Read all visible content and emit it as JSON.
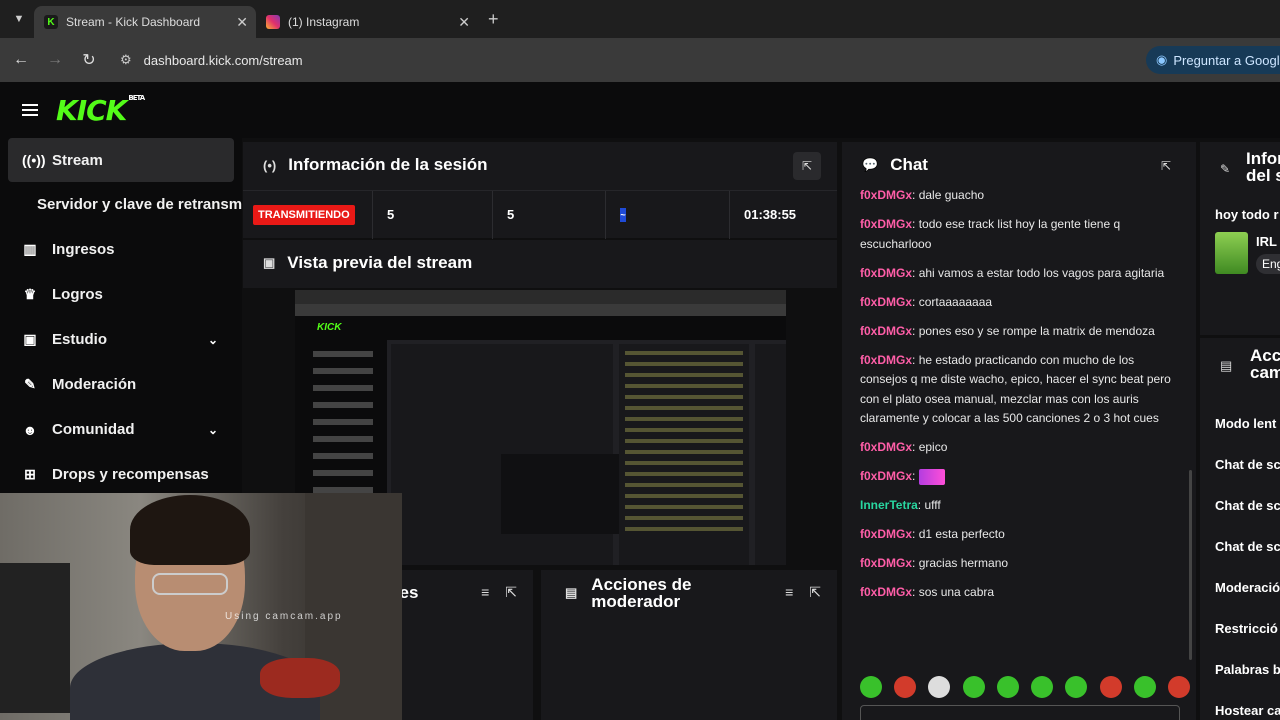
{
  "browser": {
    "tabs": [
      {
        "title": "Stream - Kick Dashboard",
        "favicon": "K"
      },
      {
        "title": "(1) Instagram"
      }
    ],
    "url": "dashboard.kick.com/stream",
    "ask_google": "Preguntar a Google"
  },
  "header": {
    "logo": "KICK",
    "beta": "BETA"
  },
  "sidebar": {
    "items": [
      {
        "label": "Stream",
        "icon": "broadcast-icon",
        "active": true
      },
      {
        "label": "Servidor y clave de retransmisión"
      },
      {
        "label": "Ingresos",
        "icon": "chart-icon"
      },
      {
        "label": "Logros",
        "icon": "trophy-icon"
      },
      {
        "label": "Estudio",
        "icon": "studio-icon",
        "expandable": true
      },
      {
        "label": "Moderación",
        "icon": "wrench-icon"
      },
      {
        "label": "Comunidad",
        "icon": "community-icon",
        "expandable": true
      },
      {
        "label": "Drops y recompensas",
        "icon": "drops-icon"
      }
    ]
  },
  "session": {
    "title": "Información de la sesión",
    "status": "TRANSMITIENDO",
    "stat1": "5",
    "stat2": "5",
    "stat3": "~",
    "duration": "01:38:55"
  },
  "preview": {
    "title": "Vista previa del stream",
    "watermark": "Using camcam.app"
  },
  "activity": {
    "title": "Actividades"
  },
  "modactions": {
    "title": "Acciones de moderador"
  },
  "chat": {
    "title": "Chat",
    "messages": [
      {
        "user": "f0xDMGx",
        "text": "dale guacho"
      },
      {
        "user": "f0xDMGx",
        "text": "todo ese track list hoy la gente tiene q escucharlooo"
      },
      {
        "user": "f0xDMGx",
        "text": "ahi vamos a estar todo los vagos para agitaria"
      },
      {
        "user": "f0xDMGx",
        "text": "cortaaaaaaaa"
      },
      {
        "user": "f0xDMGx",
        "text": "pones eso y se rompe la matrix de mendoza"
      },
      {
        "user": "f0xDMGx",
        "text": "he estado practicando con mucho de los consejos q me diste wacho, epico, hacer el sync beat pero con el plato osea manual, mezclar mas con los auris claramente y colocar a las 500 canciones 2 o 3 hot cues"
      },
      {
        "user": "f0xDMGx",
        "text": "epico"
      },
      {
        "user": "f0xDMGx",
        "text": "",
        "emote": true
      },
      {
        "user": "InnerTetra",
        "text": "ufff",
        "green": true
      },
      {
        "user": "f0xDMGx",
        "text": "d1 esta perfecto"
      },
      {
        "user": "f0xDMGx",
        "text": "gracias hermano"
      },
      {
        "user": "f0xDMGx",
        "text": "sos una cabra"
      }
    ]
  },
  "right_top": {
    "title_line1": "Infor",
    "title_line2": "del s",
    "snippet": "hoy todo r",
    "card_title": "IRL",
    "card_tag": "Eng"
  },
  "right_actions": {
    "title_line1": "Acc",
    "title_line2": "cam",
    "items": [
      "Modo lent",
      "Chat de sc",
      "Chat de sc",
      "Chat de sc",
      "Moderació",
      "Restricció",
      "Palabras b",
      "Hostear ca"
    ]
  }
}
